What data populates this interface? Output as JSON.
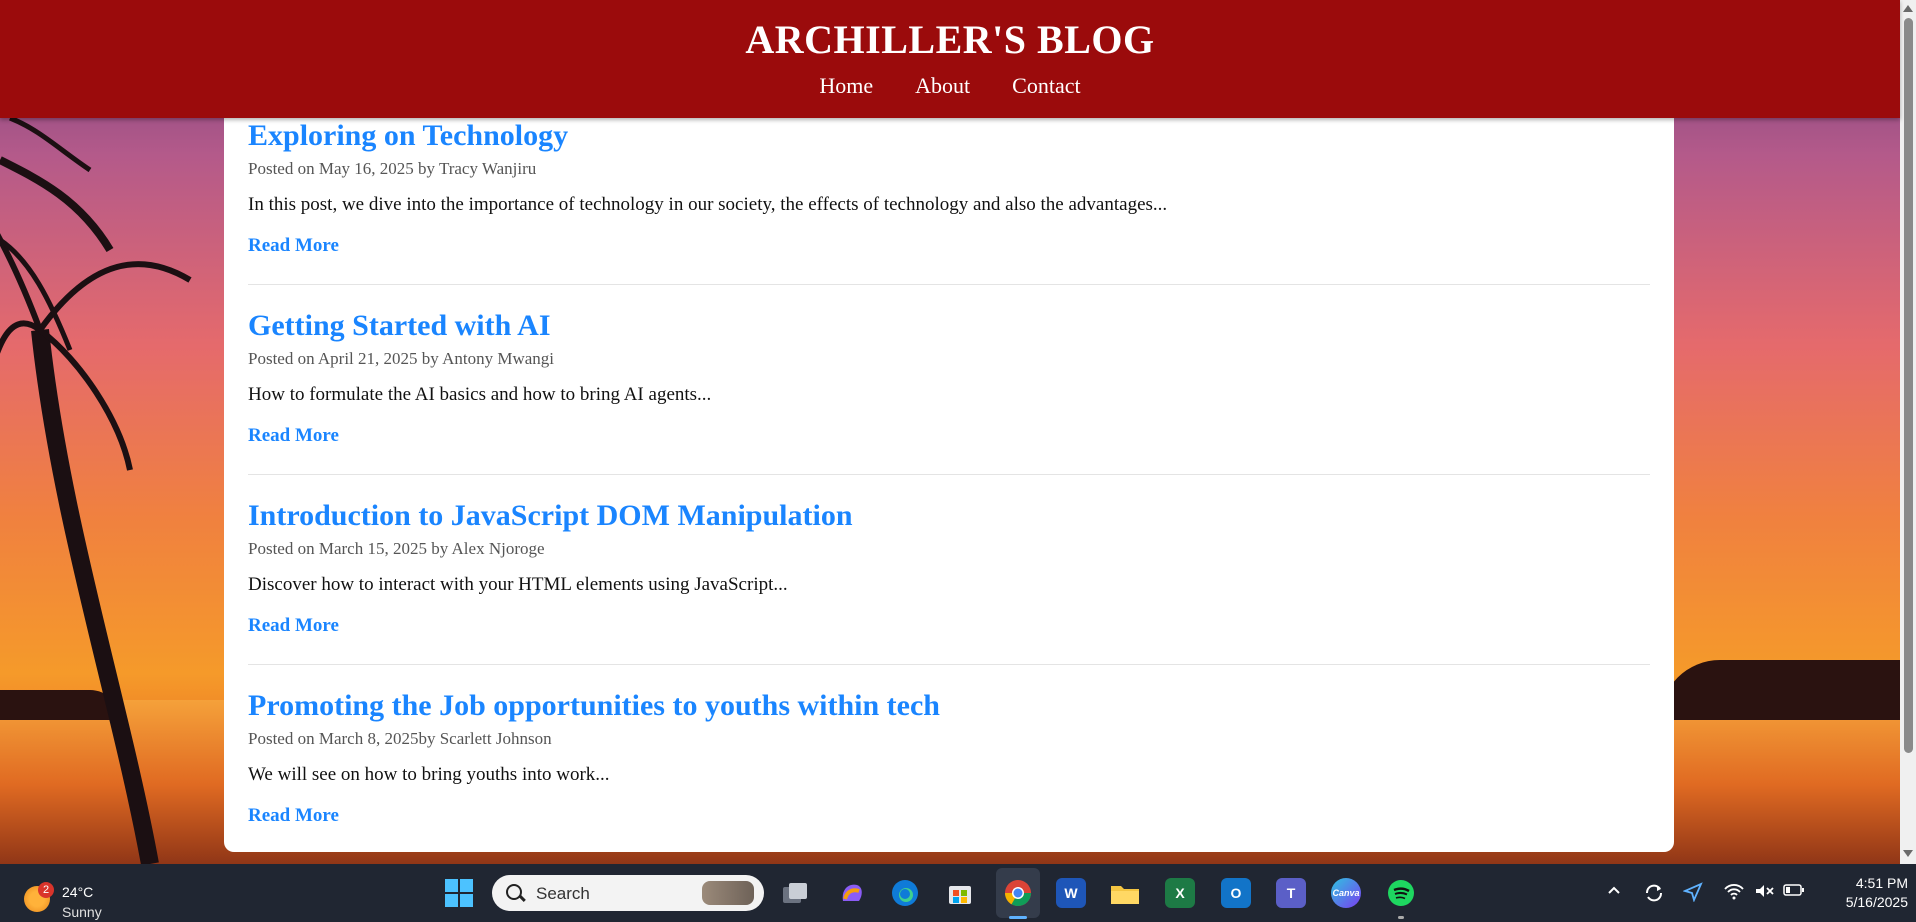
{
  "header": {
    "title": "ARCHILLER'S BLOG",
    "nav": [
      "Home",
      "About",
      "Contact"
    ]
  },
  "posts": [
    {
      "title": "Exploring on Technology",
      "meta": "Posted on May 16, 2025 by Tracy Wanjiru",
      "excerpt": "In this post, we dive into the importance of technology in our society, the effects of technology and also the advantages...",
      "read_more": "Read More"
    },
    {
      "title": "Getting Started with AI",
      "meta": "Posted on April 21, 2025 by Antony Mwangi",
      "excerpt": "How to formulate the AI basics and how to bring AI agents...",
      "read_more": "Read More"
    },
    {
      "title": "Introduction to JavaScript DOM Manipulation",
      "meta": "Posted on March 15, 2025 by Alex Njoroge",
      "excerpt": "Discover how to interact with your HTML elements using JavaScript...",
      "read_more": "Read More"
    },
    {
      "title": "Promoting the Job opportunities to youths within tech",
      "meta": "Posted on March 8, 2025by Scarlett Johnson",
      "excerpt": "We will see on how to bring youths into work...",
      "read_more": "Read More"
    }
  ],
  "colors": {
    "header_bg": "#9b0b0c",
    "link_blue": "#1a85ff",
    "taskbar_bg": "#202632"
  },
  "taskbar": {
    "weather": {
      "badge": "2",
      "temp": "24°C",
      "condition": "Sunny"
    },
    "search_label": "Search",
    "apps": [
      "windows-start",
      "task-view",
      "copilot",
      "edge",
      "microsoft-store",
      "chrome",
      "word",
      "file-explorer",
      "excel",
      "outlook",
      "teams",
      "canva",
      "spotify"
    ],
    "app_letters": {
      "word": "W",
      "excel": "X",
      "outlook": "O",
      "teams": "T",
      "canva": "Canva"
    },
    "active_app": "chrome",
    "clock": {
      "time": "4:51 PM",
      "date": "5/16/2025"
    }
  }
}
